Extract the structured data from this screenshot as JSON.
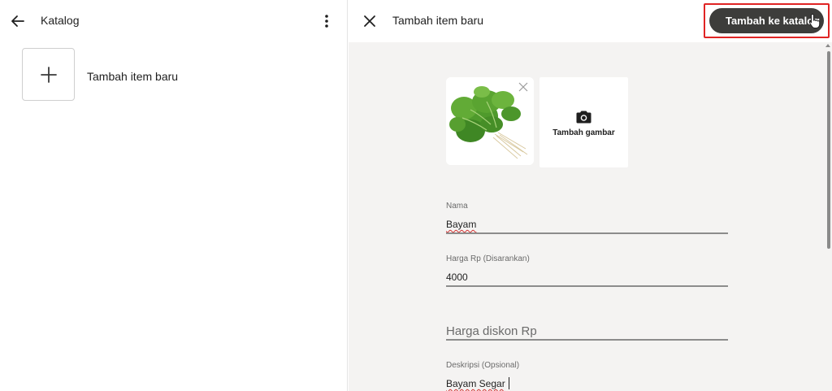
{
  "left_pane": {
    "title": "Katalog",
    "add_item_label": "Tambah item baru"
  },
  "right_pane": {
    "title": "Tambah item baru",
    "primary_button_label": "Tambah ke katalog",
    "images": {
      "add_image_label": "Tambah gambar"
    },
    "fields": {
      "name": {
        "label": "Nama",
        "value": "Bayam"
      },
      "price": {
        "label": "Harga Rp (Disarankan)",
        "value": "4000"
      },
      "discount_price": {
        "placeholder": "Harga diskon Rp",
        "value": ""
      },
      "description": {
        "label": "Deskripsi (Opsional)",
        "value": "Bayam Segar"
      }
    }
  },
  "colors": {
    "primary_button": "#3d3d3b",
    "highlight_border": "#e02424",
    "right_pane_bg": "#f4f3f2"
  },
  "icons": [
    "back-arrow-icon",
    "more-vertical-icon",
    "plus-icon",
    "close-icon",
    "camera-icon",
    "remove-image-icon",
    "mouse-cursor-icon"
  ]
}
